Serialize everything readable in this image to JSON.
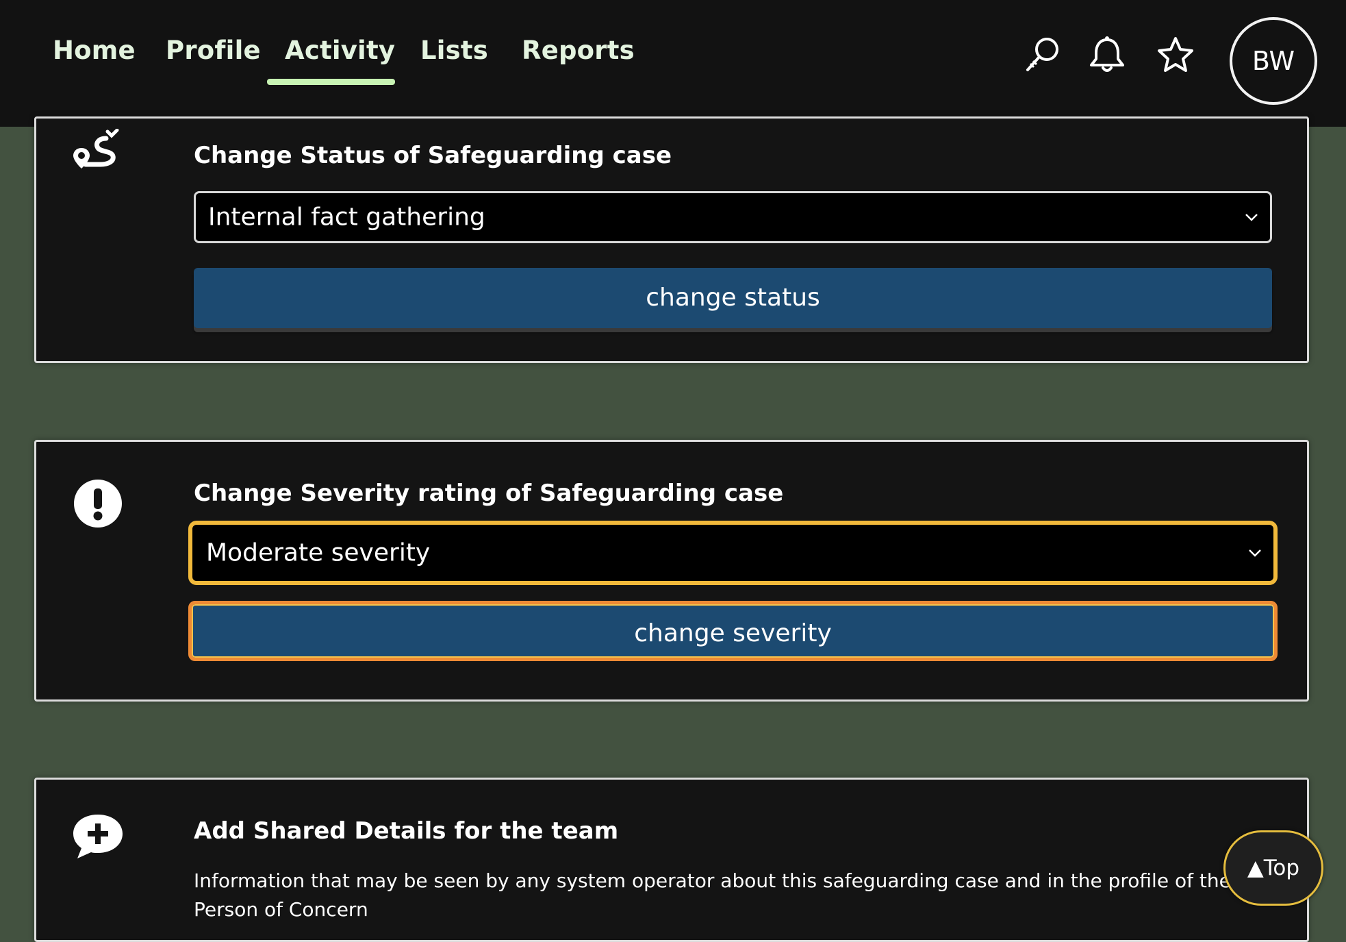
{
  "nav": {
    "items": [
      {
        "label": "Home"
      },
      {
        "label": "Profile"
      },
      {
        "label": "Activity",
        "active": true
      },
      {
        "label": "Lists"
      },
      {
        "label": "Reports"
      }
    ],
    "icons": [
      "search-icon",
      "bell-icon",
      "star-icon"
    ],
    "avatar_initials": "BW"
  },
  "status_card": {
    "icon": "route-icon",
    "title": "Change Status of Safeguarding case",
    "selected_status": "Internal fact gathering",
    "button_label": "change status"
  },
  "severity_card": {
    "icon": "exclamation-icon",
    "title": "Change Severity rating of Safeguarding case",
    "selected_severity": "Moderate severity",
    "button_label": "change severity"
  },
  "shared_details_card": {
    "icon": "add-comment-icon",
    "title": "Add Shared Details for the team",
    "description": "Information that may be seen by any system operator about this safeguarding case and in the profile of the Person of Concern"
  },
  "back_to_top": {
    "label": "▲Top"
  },
  "colors": {
    "page_background": "#435240",
    "topbar": "#121212",
    "nav_accent": "#c8f3b4",
    "button": "#1c4a71",
    "focus_ring": "#f1b93b"
  }
}
